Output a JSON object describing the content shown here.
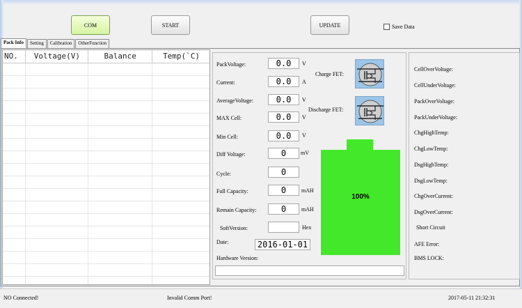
{
  "toolbar": {
    "com_label": "COM",
    "start_label": "START",
    "update_label": "UPDATE",
    "save_data_label": "Save Data"
  },
  "tabs": [
    "Pack Info",
    "Setting",
    "Calibration",
    "OtherFunction"
  ],
  "table": {
    "headers": [
      "NO.",
      "Voltage(V)",
      "Balance",
      "Temp(`C)"
    ]
  },
  "info": {
    "pack_voltage": {
      "label": "PackVoltage:",
      "value": "0.0",
      "unit": "V"
    },
    "current": {
      "label": "Current:",
      "value": "0.0",
      "unit": "A"
    },
    "average_voltage": {
      "label": "AverageVoltage:",
      "value": "0.0",
      "unit": "V"
    },
    "max_cell": {
      "label": "MAX Cell:",
      "value": "0.0",
      "unit": "V"
    },
    "min_cell": {
      "label": "Min Cell:",
      "value": "0.0",
      "unit": "V"
    },
    "diff_voltage": {
      "label": "Diff Voltage:",
      "value": "0",
      "unit": "mV"
    },
    "cycle": {
      "label": "Cycle:",
      "value": "0"
    },
    "full_capacity": {
      "label": "Full Capacity:",
      "value": "0",
      "unit": "mAH"
    },
    "remain_capacity": {
      "label": "Remain Capacity:",
      "value": "0",
      "unit": "mAH"
    },
    "soft_version": {
      "label": "SoftVersion:",
      "value": "",
      "unit": "Hex"
    },
    "date": {
      "label": "Date:",
      "value": "2016-01-01"
    },
    "hardware_version": {
      "label": "Hardware Version:",
      "value": ""
    },
    "charge_fet_label": "Charge FET:",
    "discharge_fet_label": "Discharge FET:"
  },
  "battery": {
    "percent": "100%",
    "level": 1.0,
    "color": "#44e82a"
  },
  "alarms": [
    "CellOverVoltage:",
    "CellUnderVoltage:",
    "PackOverVoltage:",
    "PackUnderVoltage:",
    "ChgHighTemp:",
    "ChgLowTemp:",
    "DsgHighTemp:",
    "DsgLowTemp:",
    "ChgOverCurrent:",
    "DsgOverCurrent:",
    "Short Circuit",
    "AFE Error:",
    "BMS LOCK:"
  ],
  "status": {
    "connection": "NO Connected!",
    "port": "Invalid Comm Port!",
    "datetime": "2017-05-11 21:32:31"
  },
  "icons": {
    "fet": "mosfet-icon"
  }
}
